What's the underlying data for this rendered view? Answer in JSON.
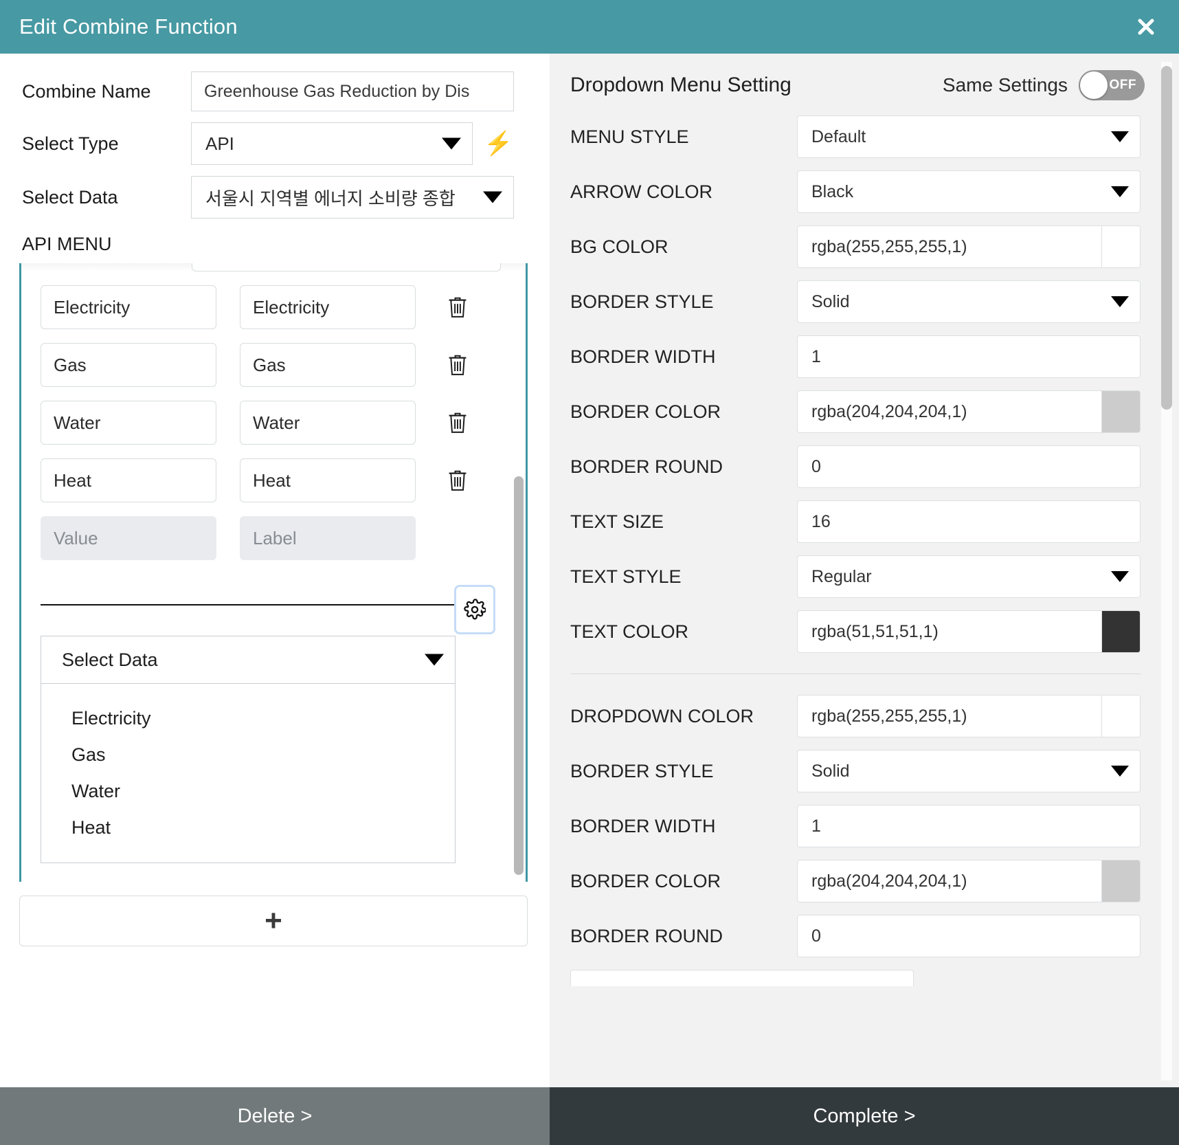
{
  "window": {
    "title": "Edit Combine Function",
    "close_icon": "close-icon",
    "header_color": "#4799a3"
  },
  "left": {
    "fields": {
      "combine_name_label": "Combine Name",
      "combine_name_value": "Greenhouse Gas Reduction by Dis",
      "select_type_label": "Select Type",
      "select_type_value": "API",
      "bolt_icon": "⚡",
      "select_data_label": "Select Data",
      "select_data_value": "서울시 지역별 에너지 소비량 종합"
    },
    "api_menu_title": "API MENU",
    "pairs": [
      {
        "value": "Electricity",
        "label": "Electricity"
      },
      {
        "value": "Gas",
        "label": "Gas"
      },
      {
        "value": "Water",
        "label": "Water"
      },
      {
        "value": "Heat",
        "label": "Heat"
      }
    ],
    "new_pair": {
      "value_placeholder": "Value",
      "label_placeholder": "Label"
    },
    "gear_icon": "gear-icon",
    "sub_select": {
      "value": "Select Data",
      "options": [
        "Electricity",
        "Gas",
        "Water",
        "Heat"
      ]
    },
    "add_button_icon": "+"
  },
  "right": {
    "title": "Dropdown Menu Setting",
    "same_settings_label": "Same Settings",
    "toggle_state": "OFF",
    "group1": [
      {
        "key": "MENU STYLE",
        "value": "Default",
        "kind": "select"
      },
      {
        "key": "ARROW COLOR",
        "value": "Black",
        "kind": "select"
      },
      {
        "key": "BG COLOR",
        "value": "rgba(255,255,255,1)",
        "kind": "color",
        "swatch": "#ffffff"
      },
      {
        "key": "BORDER STYLE",
        "value": "Solid",
        "kind": "select"
      },
      {
        "key": "BORDER WIDTH",
        "value": "1",
        "kind": "text"
      },
      {
        "key": "BORDER COLOR",
        "value": "rgba(204,204,204,1)",
        "kind": "color",
        "swatch": "#cccccc"
      },
      {
        "key": "BORDER ROUND",
        "value": "0",
        "kind": "text"
      },
      {
        "key": "TEXT SIZE",
        "value": "16",
        "kind": "text"
      },
      {
        "key": "TEXT STYLE",
        "value": "Regular",
        "kind": "select"
      },
      {
        "key": "TEXT COLOR",
        "value": "rgba(51,51,51,1)",
        "kind": "color",
        "swatch": "#333333"
      }
    ],
    "group2": [
      {
        "key": "DROPDOWN COLOR",
        "value": "rgba(255,255,255,1)",
        "kind": "color",
        "swatch": "#ffffff"
      },
      {
        "key": "BORDER STYLE",
        "value": "Solid",
        "kind": "select"
      },
      {
        "key": "BORDER WIDTH",
        "value": "1",
        "kind": "text"
      },
      {
        "key": "BORDER COLOR",
        "value": "rgba(204,204,204,1)",
        "kind": "color",
        "swatch": "#cccccc"
      },
      {
        "key": "BORDER ROUND",
        "value": "0",
        "kind": "text"
      }
    ]
  },
  "footer": {
    "delete_label": "Delete >",
    "complete_label": "Complete >"
  }
}
